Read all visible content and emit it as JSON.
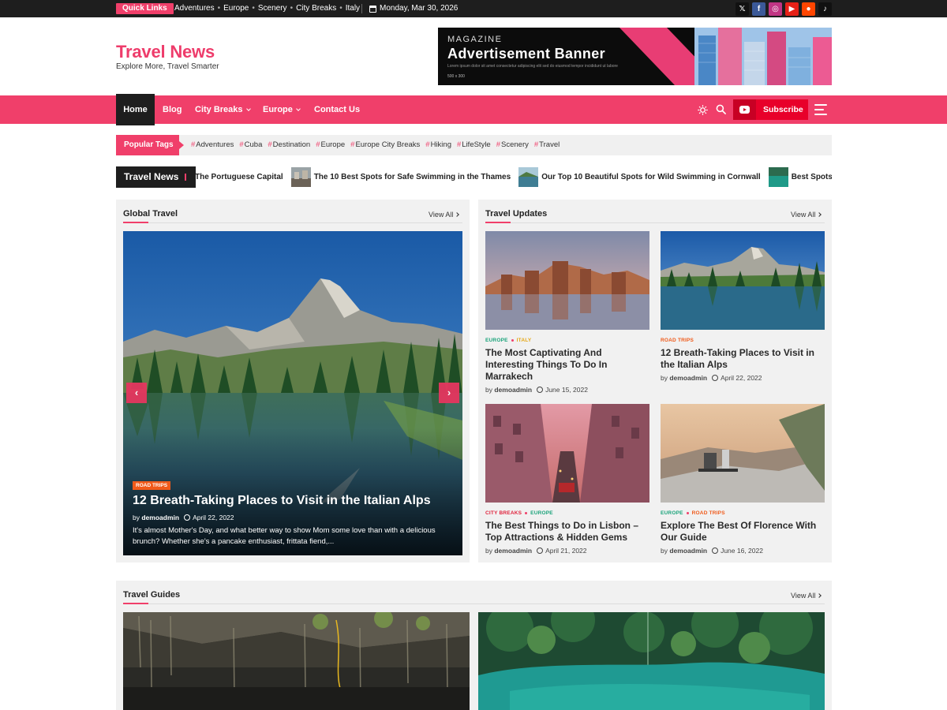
{
  "topbar": {
    "quick_links_label": "Quick Links",
    "links": [
      "Adventures",
      "Europe",
      "Scenery",
      "City Breaks",
      "Italy"
    ],
    "date": "Monday, Mar 30, 2026",
    "socials": [
      {
        "icon": "x-icon",
        "glyph": "𝕏",
        "color": "#111111"
      },
      {
        "icon": "facebook-icon",
        "glyph": "f",
        "color": "#3b5998"
      },
      {
        "icon": "instagram-icon",
        "glyph": "◎",
        "color": "#c13584"
      },
      {
        "icon": "youtube-icon",
        "glyph": "▶",
        "color": "#e62117"
      },
      {
        "icon": "reddit-icon",
        "glyph": "●",
        "color": "#ff4500"
      },
      {
        "icon": "tiktok-icon",
        "glyph": "♪",
        "color": "#111111"
      }
    ]
  },
  "header": {
    "site_title": "Travel News",
    "tagline": "Explore More, Travel Smarter",
    "ad": {
      "kicker": "MAGAZINE",
      "title": "Advertisement Banner",
      "fine_print": "Lorem ipsum dolor sit amet consectetur adipiscing elit sed do eiusmod tempor incididunt ut labore",
      "size": "500 x 300"
    }
  },
  "nav": {
    "items": [
      {
        "label": "Home",
        "active": true
      },
      {
        "label": "Blog"
      },
      {
        "label": "City Breaks",
        "dropdown": true
      },
      {
        "label": "Europe",
        "dropdown": true
      },
      {
        "label": "Contact Us"
      }
    ],
    "subscribe_label": "Subscribe"
  },
  "tags": {
    "label": "Popular Tags",
    "items": [
      "Adventures",
      "Cuba",
      "Destination",
      "Europe",
      "Europe City Breaks",
      "Hiking",
      "LifeStyle",
      "Scenery",
      "Travel"
    ]
  },
  "ticker": {
    "label": "Travel News",
    "items": [
      "The Portuguese Capital",
      "The 10 Best Spots for Safe Swimming in the Thames",
      "Our Top 10 Beautiful Spots for Wild Swimming in Cornwall",
      "Best Spots for an"
    ]
  },
  "global_travel": {
    "title": "Global Travel",
    "view_all": "View All",
    "hero": {
      "category": "ROAD TRIPS",
      "title": "12 Breath-Taking Places to Visit in the Italian Alps",
      "by": "by",
      "author": "demoadmin",
      "date": "April 22, 2022",
      "excerpt": "It's almost Mother's Day, and what better way to show Mom some love than with a delicious brunch? Whether she's a pancake enthusiast, frittata fiend,..."
    }
  },
  "travel_updates": {
    "title": "Travel Updates",
    "view_all": "View All",
    "cards": [
      {
        "cats": [
          "EUROPE",
          "ITALY"
        ],
        "cat_color": "#1aa37a",
        "cat2_color": "#e6a817",
        "title": "The Most Captivating And Interesting Things To Do In Marrakech",
        "by": "by",
        "author": "demoadmin",
        "date": "June 15, 2022"
      },
      {
        "cats": [
          "ROAD TRIPS"
        ],
        "cat_color": "#f05a1a",
        "title": "12 Breath-Taking Places to Visit in the Italian Alps",
        "by": "by",
        "author": "demoadmin",
        "date": "April 22, 2022"
      },
      {
        "cats": [
          "CITY BREAKS",
          "EUROPE"
        ],
        "cat_color": "#e0243d",
        "cat2_color": "#1aa37a",
        "title": "The Best Things to Do in Lisbon – Top Attractions & Hidden Gems",
        "by": "by",
        "author": "demoadmin",
        "date": "April 21, 2022"
      },
      {
        "cats": [
          "EUROPE",
          "ROAD TRIPS"
        ],
        "cat_color": "#1aa37a",
        "cat2_color": "#f05a1a",
        "title": "Explore The Best Of Florence With Our Guide",
        "by": "by",
        "author": "demoadmin",
        "date": "June 16, 2022"
      }
    ]
  },
  "travel_guides": {
    "title": "Travel Guides",
    "view_all": "View All"
  },
  "colors": {
    "accent": "#f03f6a",
    "dark": "#1e1e1e"
  }
}
